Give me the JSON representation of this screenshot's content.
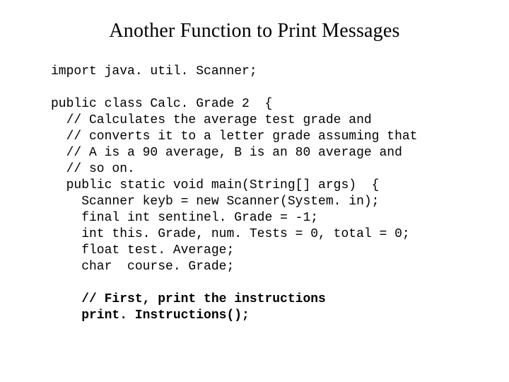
{
  "title": "Another Function to Print Messages",
  "code": {
    "l01": "import java. util. Scanner;",
    "l02": "",
    "l03": "public class Calc. Grade 2  {",
    "l04": "  // Calculates the average test grade and",
    "l05": "  // converts it to a letter grade assuming that",
    "l06": "  // A is a 90 average, B is an 80 average and",
    "l07": "  // so on.",
    "l08": "  public static void main(String[] args)  {",
    "l09": "    Scanner keyb = new Scanner(System. in);",
    "l10": "    final int sentinel. Grade = -1;",
    "l11": "    int this. Grade, num. Tests = 0, total = 0;",
    "l12": "    float test. Average;",
    "l13": "    char  course. Grade;",
    "l14": "",
    "l15": "    // First, print the instructions",
    "l16": "    print. Instructions();"
  }
}
